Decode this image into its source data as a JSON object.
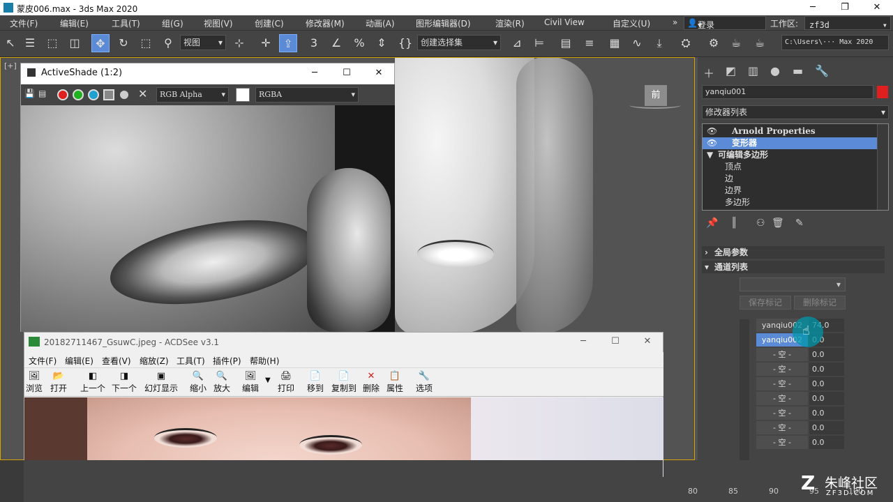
{
  "window": {
    "title": "蒙皮006.max - 3ds Max 2020"
  },
  "menu": [
    "文件(F)",
    "编辑(E)",
    "工具(T)",
    "组(G)",
    "视图(V)",
    "创建(C)",
    "修改器(M)",
    "动画(A)",
    "图形编辑器(D)",
    "渲染(R)",
    "Civil View",
    "自定义(U)"
  ],
  "login": "登录",
  "workspace": {
    "label": "工作区:",
    "value": "zf3d"
  },
  "toolbar": {
    "view_dropdown": "视图",
    "selection_set": "创建选择集",
    "path": "C:\\Users\\··· Max 2020",
    "angle_snap": "3",
    "snap_3": "3"
  },
  "viewport": {
    "label": "[+]",
    "navcube_face": "前"
  },
  "panel": {
    "object_name": "yanqiu001",
    "object_color": "#e02020",
    "modifier_list": "修改器列表",
    "stack": [
      {
        "label": "Arnold Properties",
        "bold": true,
        "selected": false
      },
      {
        "label": "变形器",
        "bold": true,
        "selected": true
      },
      {
        "label": "可编辑多边形",
        "bold": true,
        "selected": false
      },
      {
        "label": "顶点",
        "bold": false,
        "selected": false
      },
      {
        "label": "边",
        "bold": false,
        "selected": false
      },
      {
        "label": "边界",
        "bold": false,
        "selected": false
      },
      {
        "label": "多边形",
        "bold": false,
        "selected": false
      }
    ],
    "rollout_global": "全局参数",
    "rollout_channels": "通道列表",
    "save_marker": "保存标记",
    "delete_marker": "删除标记",
    "channels": [
      {
        "name": "yanqiu002",
        "value": "74.0",
        "highlight": false
      },
      {
        "name": "yanqiu002",
        "value": "0.0",
        "highlight": true
      },
      {
        "name": "- 空 -",
        "value": "0.0",
        "highlight": false
      },
      {
        "name": "- 空 -",
        "value": "0.0",
        "highlight": false
      },
      {
        "name": "- 空 -",
        "value": "0.0",
        "highlight": false
      },
      {
        "name": "- 空 -",
        "value": "0.0",
        "highlight": false
      },
      {
        "name": "- 空 -",
        "value": "0.0",
        "highlight": false
      },
      {
        "name": "- 空 -",
        "value": "0.0",
        "highlight": false
      },
      {
        "name": "- 空 -",
        "value": "0.0",
        "highlight": false
      }
    ]
  },
  "activeshade": {
    "title": "ActiveShade (1:2)",
    "channel_dropdown": "RGB Alpha",
    "mode_dropdown": "RGBA"
  },
  "acdsee": {
    "title": "20182711467_GsuwC.jpeg - ACDSee v3.1",
    "menu": [
      "文件(F)",
      "编辑(E)",
      "查看(V)",
      "缩放(Z)",
      "工具(T)",
      "插件(P)",
      "帮助(H)"
    ],
    "tools": [
      "浏览",
      "打开",
      "上一个",
      "下一个",
      "幻灯显示",
      "缩小",
      "放大",
      "编辑",
      "打印",
      "移到",
      "复制到",
      "删除",
      "属性",
      "选项"
    ]
  },
  "timeline": [
    "80",
    "85",
    "90",
    "95",
    "100"
  ],
  "watermark": {
    "brand": "朱峰社区",
    "site": "ZF3D.COM"
  }
}
